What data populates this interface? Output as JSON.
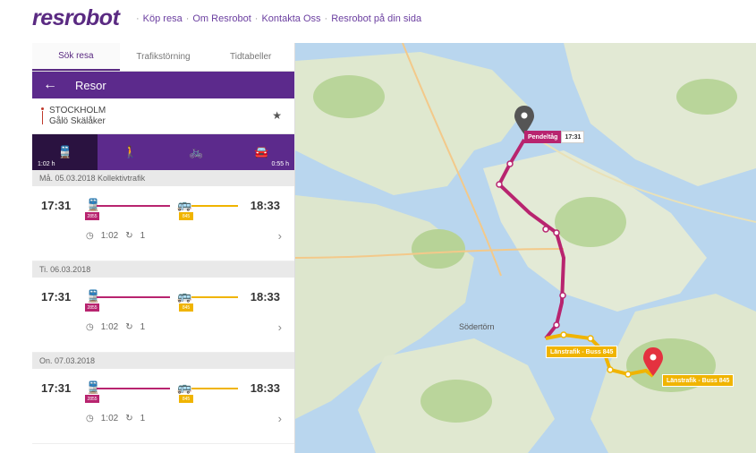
{
  "header": {
    "logo": "resrobot",
    "nav": [
      "Köp resa",
      "Om Resrobot",
      "Kontakta Oss",
      "Resrobot på din sida"
    ],
    "nav_separator": "·"
  },
  "tabs": [
    {
      "label": "Sök resa",
      "active": true
    },
    {
      "label": "Trafikstörning",
      "active": false
    },
    {
      "label": "Tidtabeller",
      "active": false
    }
  ],
  "trip_header": {
    "back_icon": "arrow-left-icon",
    "title": "Resor"
  },
  "route": {
    "from": "STOCKHOLM",
    "to": "Gålö Skälåker",
    "star_icon": "star-icon"
  },
  "modes": [
    {
      "icon": "train-icon",
      "glyph": "⛭",
      "time": "1:02 h",
      "active": true
    },
    {
      "icon": "walk-icon",
      "glyph": "🚶",
      "time": "",
      "active": false
    },
    {
      "icon": "bike-icon",
      "glyph": "🚲",
      "time": "",
      "active": false
    },
    {
      "icon": "car-icon",
      "glyph": "🚘",
      "time": "0:55 h",
      "active": false
    }
  ],
  "trips": [
    {
      "date": "Må. 05.03.2018 Kollektivtrafik",
      "dep": "17:31",
      "arr": "18:33",
      "train_line": "2855",
      "bus_line": "845",
      "duration": "1:02",
      "changes": "1"
    },
    {
      "date": "Ti. 06.03.2018",
      "dep": "17:31",
      "arr": "18:33",
      "train_line": "2855",
      "bus_line": "845",
      "duration": "1:02",
      "changes": "1"
    },
    {
      "date": "On. 07.03.2018",
      "dep": "17:31",
      "arr": "18:33",
      "train_line": "2855",
      "bus_line": "845",
      "duration": "1:02",
      "changes": "1"
    }
  ],
  "map": {
    "labels": [
      "Södertörn",
      "Stockholm"
    ],
    "pendeltag_label": "Pendeltåg",
    "pendeltag_time": "17:31",
    "bus_label_1": "Länstrafik - Buss 845",
    "bus_label_2": "Länstrafik - Buss 845",
    "colors": {
      "train": "#b8246f",
      "bus": "#f0b400",
      "brand": "#5c2a8c"
    }
  }
}
